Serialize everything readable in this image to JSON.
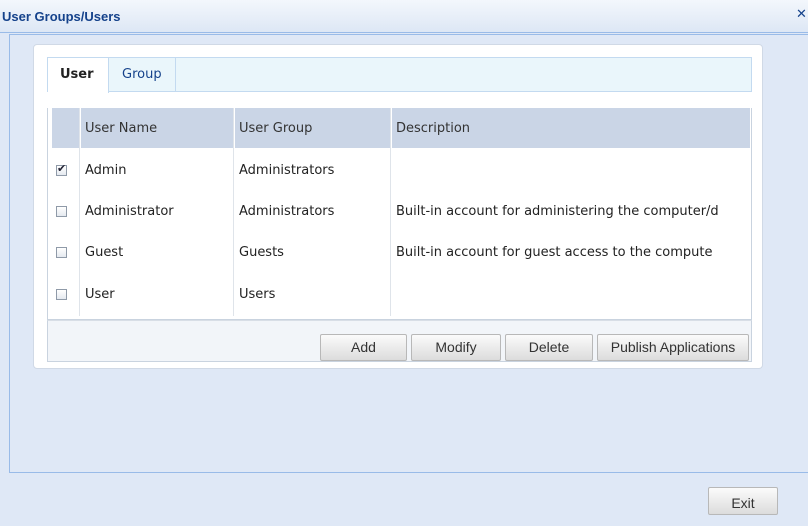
{
  "window": {
    "title": "User Groups/Users",
    "close_icon": "close-icon"
  },
  "tabs": [
    {
      "label": "User",
      "active": true
    },
    {
      "label": "Group",
      "active": false
    }
  ],
  "grid": {
    "columns": [
      "User Name",
      "User Group",
      "Description"
    ],
    "rows": [
      {
        "checked": true,
        "user_name": "Admin",
        "user_group": "Administrators",
        "description": ""
      },
      {
        "checked": false,
        "user_name": "Administrator",
        "user_group": "Administrators",
        "description": "Built-in account for administering the computer/d"
      },
      {
        "checked": false,
        "user_name": "Guest",
        "user_group": "Guests",
        "description": "Built-in account for guest access to the compute"
      },
      {
        "checked": false,
        "user_name": "User",
        "user_group": "Users",
        "description": ""
      }
    ]
  },
  "toolbar": {
    "add_label": "Add",
    "modify_label": "Modify",
    "delete_label": "Delete",
    "publish_label": "Publish Applications"
  },
  "footer": {
    "exit_label": "Exit"
  },
  "colors": {
    "title": "#15428b",
    "header_bg": "#cad5e6",
    "tabstrip_bg": "#eaf6fb",
    "window_bg": "#dfe8f6"
  }
}
